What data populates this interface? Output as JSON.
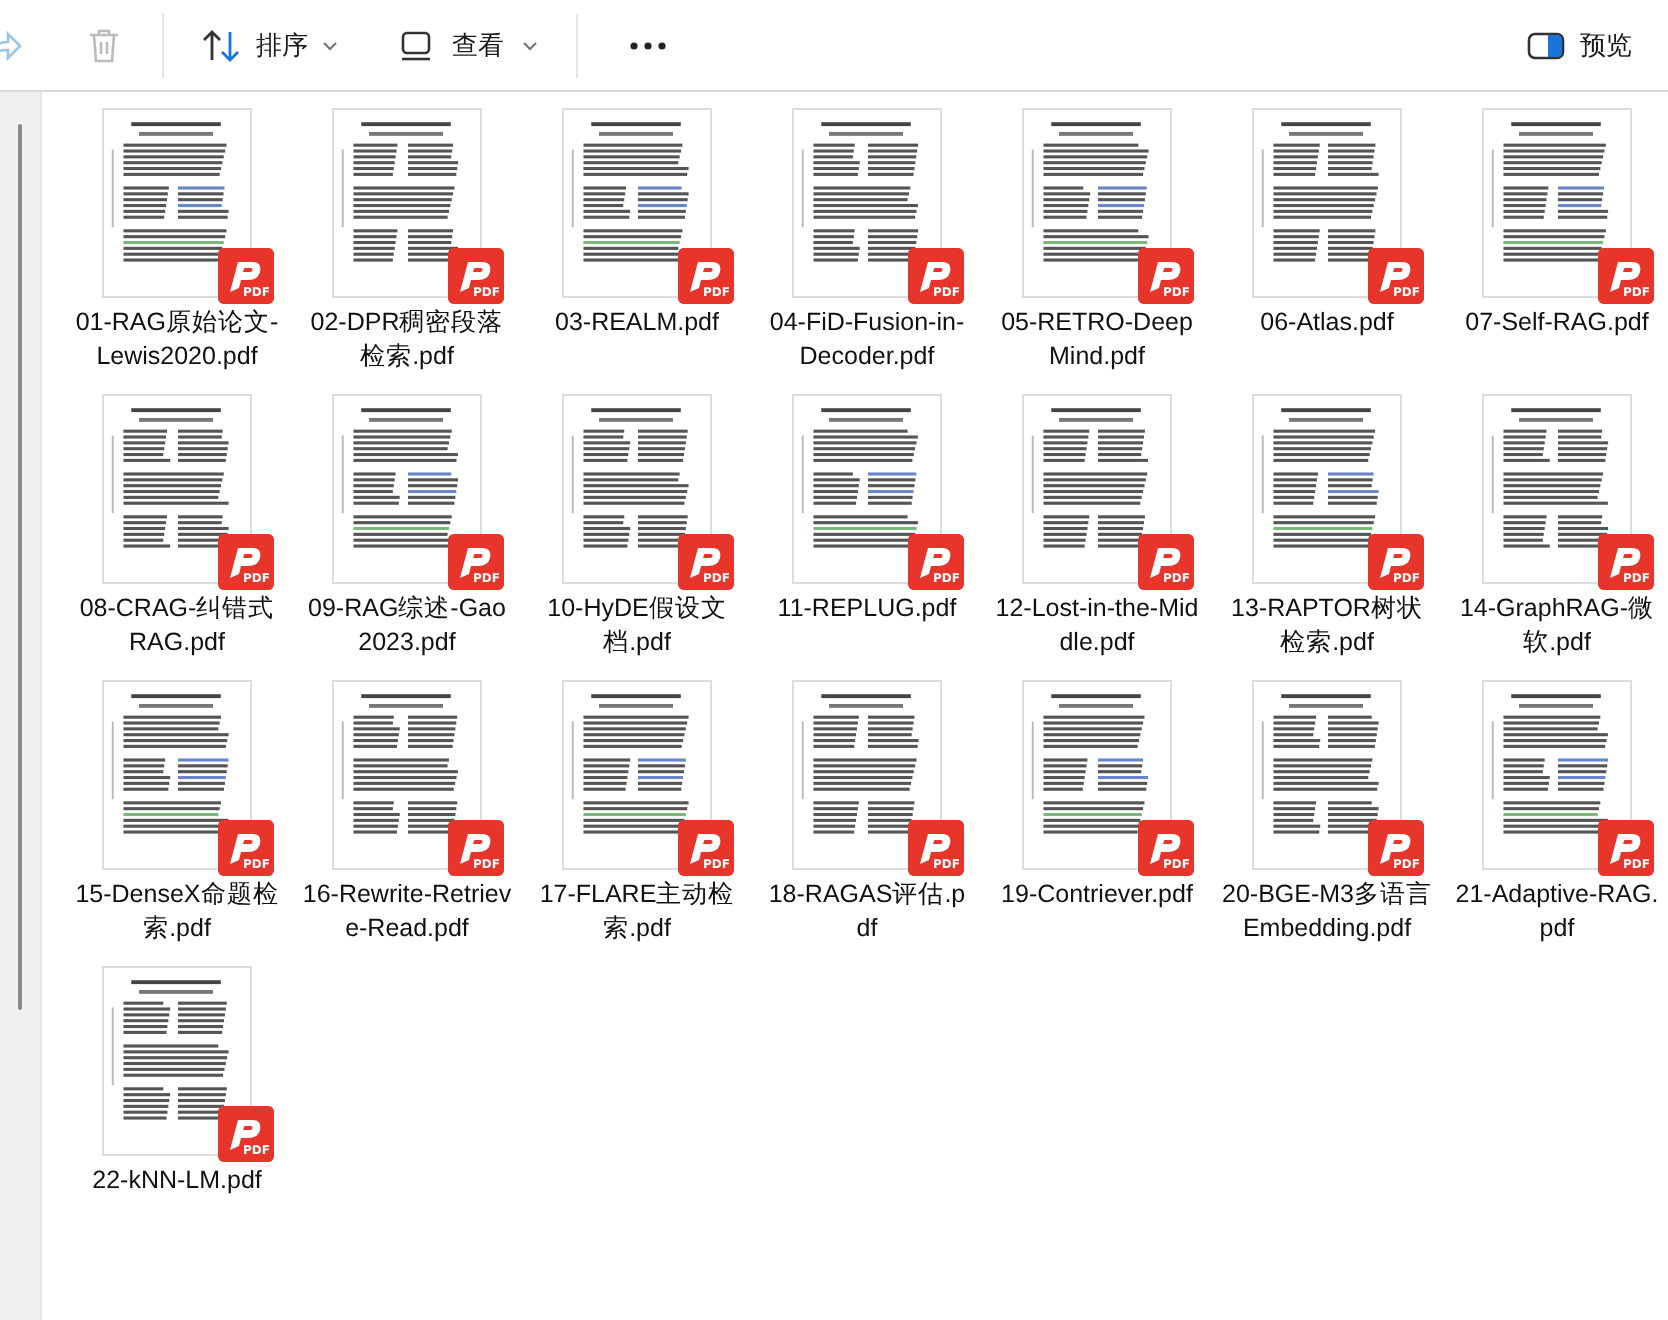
{
  "toolbar": {
    "items": [
      {
        "kind": "share",
        "disabled": true
      },
      {
        "kind": "delete",
        "disabled": true
      },
      {
        "kind": "divider"
      },
      {
        "kind": "sort",
        "label": "排序"
      },
      {
        "kind": "view",
        "label": "查看"
      },
      {
        "kind": "divider"
      },
      {
        "kind": "more"
      }
    ],
    "preview": {
      "label": "预览"
    }
  },
  "files": [
    {
      "name": "01-RAG原始论文-Lewis2020.pdf",
      "badge": "PDF"
    },
    {
      "name": "02-DPR稠密段落检索.pdf",
      "badge": "PDF"
    },
    {
      "name": "03-REALM.pdf",
      "badge": "PDF"
    },
    {
      "name": "04-FiD-Fusion-in-Decoder.pdf",
      "badge": "PDF"
    },
    {
      "name": "05-RETRO-DeepMind.pdf",
      "badge": "PDF"
    },
    {
      "name": "06-Atlas.pdf",
      "badge": "PDF"
    },
    {
      "name": "07-Self-RAG.pdf",
      "badge": "PDF"
    },
    {
      "name": "08-CRAG-纠错式RAG.pdf",
      "badge": "PDF"
    },
    {
      "name": "09-RAG综述-Gao2023.pdf",
      "badge": "PDF"
    },
    {
      "name": "10-HyDE假设文档.pdf",
      "badge": "PDF"
    },
    {
      "name": "11-REPLUG.pdf",
      "badge": "PDF"
    },
    {
      "name": "12-Lost-in-the-Middle.pdf",
      "badge": "PDF"
    },
    {
      "name": "13-RAPTOR树状检索.pdf",
      "badge": "PDF"
    },
    {
      "name": "14-GraphRAG-微软.pdf",
      "badge": "PDF"
    },
    {
      "name": "15-DenseX命题检索.pdf",
      "badge": "PDF"
    },
    {
      "name": "16-Rewrite-Retrieve-Read.pdf",
      "badge": "PDF"
    },
    {
      "name": "17-FLARE主动检索.pdf",
      "badge": "PDF"
    },
    {
      "name": "18-RAGAS评估.pdf",
      "badge": "PDF"
    },
    {
      "name": "19-Contriever.pdf",
      "badge": "PDF"
    },
    {
      "name": "20-BGE-M3多语言Embedding.pdf",
      "badge": "PDF"
    },
    {
      "name": "21-Adaptive-RAG.pdf",
      "badge": "PDF"
    },
    {
      "name": "22-kNN-LM.pdf",
      "badge": "PDF"
    }
  ]
}
